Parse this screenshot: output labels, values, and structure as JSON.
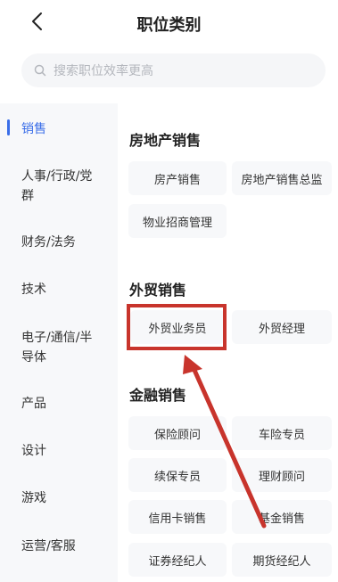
{
  "header": {
    "title": "职位类别"
  },
  "search": {
    "placeholder": "搜索职位效率更高"
  },
  "sidebar": {
    "items": [
      {
        "label": "销售"
      },
      {
        "label": "人事/行政/党群"
      },
      {
        "label": "财务/法务"
      },
      {
        "label": "技术"
      },
      {
        "label": "电子/通信/半导体"
      },
      {
        "label": "产品"
      },
      {
        "label": "设计"
      },
      {
        "label": "游戏"
      },
      {
        "label": "运营/客服"
      }
    ]
  },
  "sections": [
    {
      "title": "房地产销售",
      "chips": [
        "房产销售",
        "房地产销售总监",
        "物业招商管理"
      ]
    },
    {
      "title": "外贸销售",
      "chips": [
        "外贸业务员",
        "外贸经理"
      ]
    },
    {
      "title": "金融销售",
      "chips": [
        "保险顾问",
        "车险专员",
        "续保专员",
        "理财顾问",
        "信用卡销售",
        "基金销售",
        "证券经纪人",
        "期货经纪人"
      ]
    }
  ],
  "colors": {
    "accent": "#3a6ee8",
    "annotation": "#c8342c"
  }
}
